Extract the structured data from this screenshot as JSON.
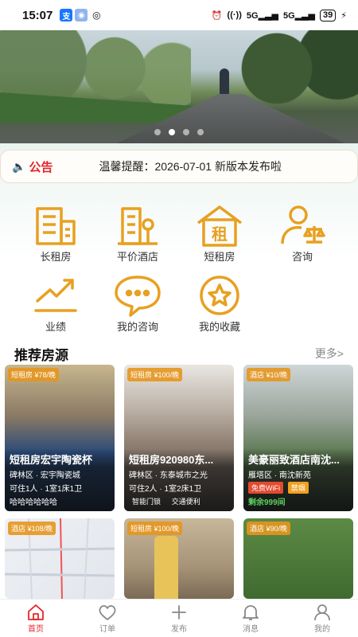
{
  "status_bar": {
    "time": "15:07",
    "network": "5G",
    "battery": "39"
  },
  "banner": {
    "slides": 4,
    "active_slide": 1
  },
  "notice": {
    "label": "公告",
    "text": "温馨提醒：2026-07-01 新版本发布啦"
  },
  "menu": [
    {
      "label": "长租房",
      "icon": "building-icon"
    },
    {
      "label": "平价酒店",
      "icon": "hotel-icon"
    },
    {
      "label": "短租房",
      "icon": "rent-house-icon"
    },
    {
      "label": "咨询",
      "icon": "consult-person-icon"
    },
    {
      "label": "业绩",
      "icon": "trend-icon"
    },
    {
      "label": "我的咨询",
      "icon": "chat-bubble-icon"
    },
    {
      "label": "我的收藏",
      "icon": "star-icon"
    }
  ],
  "section": {
    "title": "推荐房源",
    "more": "更多>"
  },
  "listings": [
    {
      "tag": "短租房 ¥78/晚",
      "title": "短租房宏宇陶瓷杯",
      "location": "碑林区 · 宏宇陶瓷城",
      "info": "可住1人 · 1室1床1卫",
      "extra": "哈哈哈哈哈哈",
      "color": "#3a4e68"
    },
    {
      "tag": "短租房 ¥100/晚",
      "title": "短租房920980东...",
      "location": "碑林区 · 东泰城市之光",
      "info": "可住2人 · 1室2床1卫",
      "features": [
        "智能门锁",
        "交通便利"
      ],
      "color": "#9a8f86"
    },
    {
      "tag": "酒店 ¥10/晚",
      "title": "美豪丽致酒店南沈...",
      "location": "雁塔区 · 南沈新苑",
      "features": [
        "免费WiFi",
        "禁烟"
      ],
      "rooms_left": "剩余999间",
      "color": "#6d7f6a"
    },
    {
      "tag": "酒店 ¥108/晚",
      "color": "#e8eaef"
    },
    {
      "tag": "短租房 ¥100/晚",
      "color": "#b8a78c"
    },
    {
      "tag": "酒店 ¥90/晚",
      "color": "#4f7b3a"
    }
  ],
  "bottom_nav": [
    {
      "label": "首页",
      "icon": "home-icon",
      "active": true
    },
    {
      "label": "订单",
      "icon": "heart-icon",
      "active": false
    },
    {
      "label": "发布",
      "icon": "plus-icon",
      "active": false
    },
    {
      "label": "消息",
      "icon": "bell-icon",
      "active": false
    },
    {
      "label": "我的",
      "icon": "user-icon",
      "active": false
    }
  ],
  "colors": {
    "accent": "#e3262b",
    "icon": "#e8a020"
  }
}
